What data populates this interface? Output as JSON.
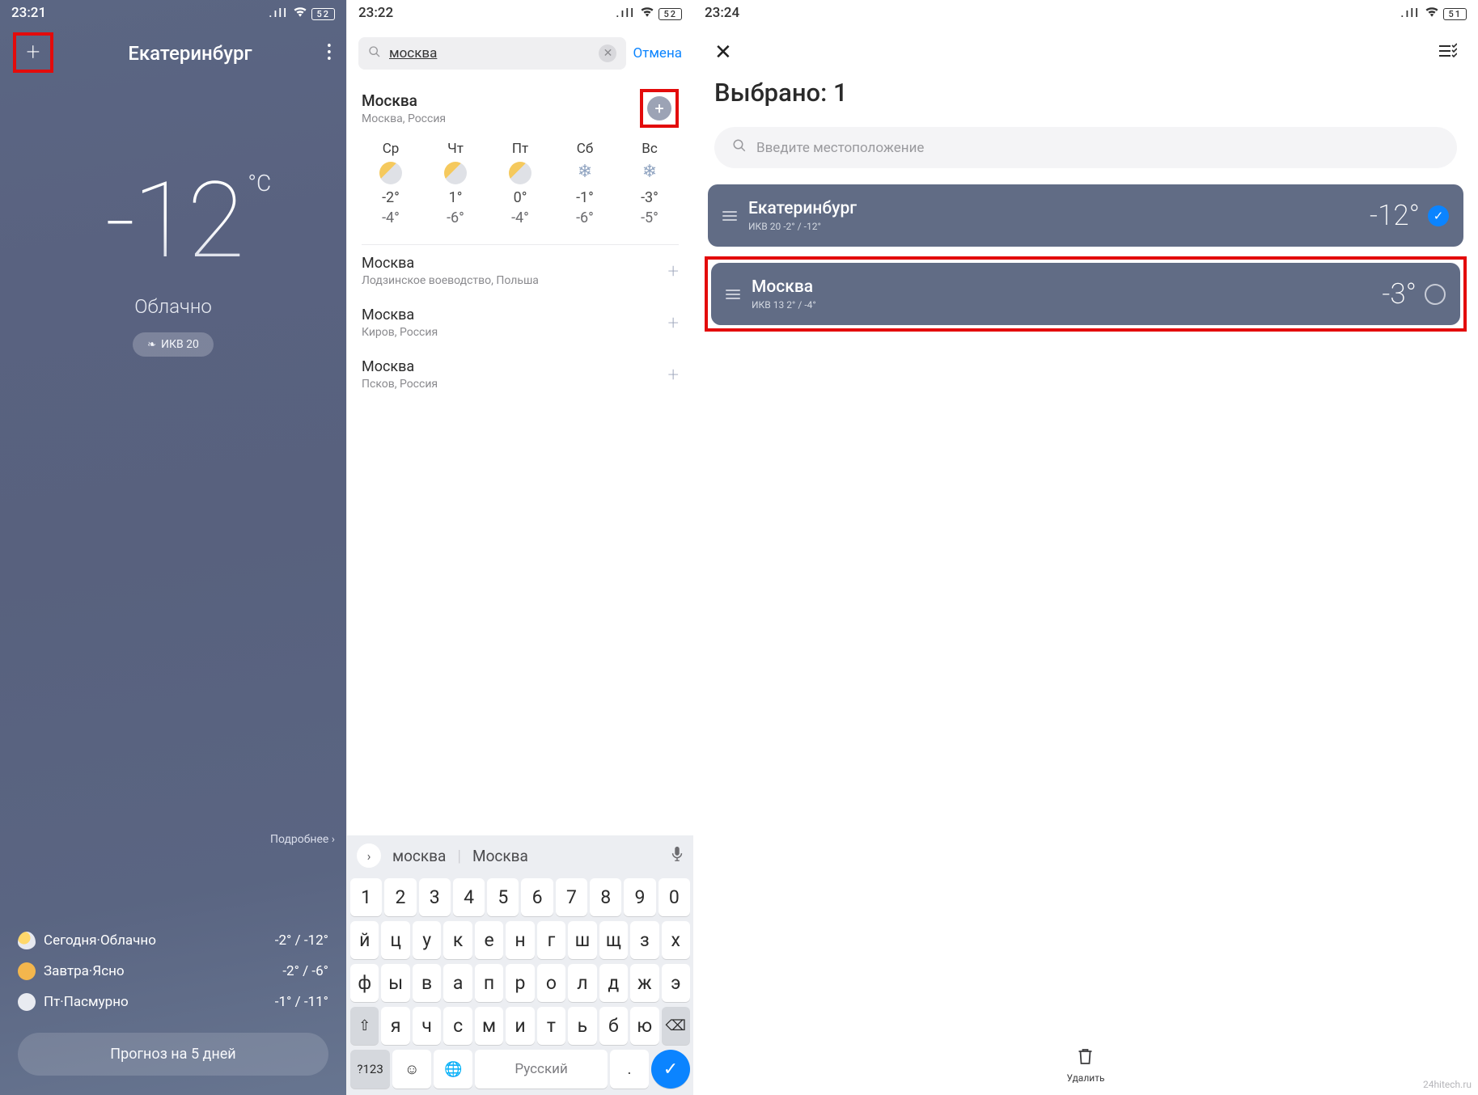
{
  "status": {
    "battery1": "52",
    "battery2": "52",
    "battery3": "51",
    "signal": "▫▪▪▪",
    "wifi": "📶"
  },
  "s1": {
    "time": "23:21",
    "city": "Екатеринбург",
    "temp": "-12",
    "unit": "°C",
    "condition": "Облачно",
    "aqi": "ИКВ 20",
    "details": "Подробнее ",
    "days": [
      {
        "label": "Сегодня·Облачно",
        "range": "-2° / -12°"
      },
      {
        "label": "Завтра·Ясно",
        "range": "-2° / -6°"
      },
      {
        "label": "Пт·Пасмурно",
        "range": "-1° / -11°"
      }
    ],
    "forecast_btn": "Прогноз на 5 дней"
  },
  "s2": {
    "time": "23:22",
    "query": "москва",
    "cancel": "Отмена",
    "primary": {
      "title": "Москва",
      "sub": "Москва, Россия"
    },
    "forecast": [
      {
        "d": "Ср",
        "icon": "pc",
        "hi": "-2°",
        "lo": "-4°"
      },
      {
        "d": "Чт",
        "icon": "pc",
        "hi": "1°",
        "lo": "-6°"
      },
      {
        "d": "Пт",
        "icon": "pc",
        "hi": "0°",
        "lo": "-4°"
      },
      {
        "d": "Сб",
        "icon": "snow",
        "hi": "-1°",
        "lo": "-6°"
      },
      {
        "d": "Вс",
        "icon": "snow",
        "hi": "-3°",
        "lo": "-5°"
      }
    ],
    "alts": [
      {
        "title": "Москва",
        "sub": "Лодзинское воеводство, Польша"
      },
      {
        "title": "Москва",
        "sub": "Киров, Россия"
      },
      {
        "title": "Москва",
        "sub": "Псков, Россия"
      }
    ],
    "kbd": {
      "sug1": "москва",
      "sug2": "Москва",
      "row1": [
        "1",
        "2",
        "3",
        "4",
        "5",
        "6",
        "7",
        "8",
        "9",
        "0"
      ],
      "row2": [
        "й",
        "ц",
        "у",
        "к",
        "е",
        "н",
        "г",
        "ш",
        "щ",
        "з",
        "х"
      ],
      "row3": [
        "ф",
        "ы",
        "в",
        "а",
        "п",
        "р",
        "о",
        "л",
        "д",
        "ж",
        "э"
      ],
      "row4": [
        "⇧",
        "я",
        "ч",
        "с",
        "м",
        "и",
        "т",
        "ь",
        "б",
        "ю",
        "⌫"
      ],
      "numkey": "?123",
      "space": "Русский"
    }
  },
  "s3": {
    "time": "23:24",
    "title": "Выбрано: 1",
    "search_placeholder": "Введите местоположение",
    "cards": [
      {
        "city": "Екатеринбург",
        "sub": "ИКВ 20   -2° / -12°",
        "temp": "-12°",
        "selected": true
      },
      {
        "city": "Москва",
        "sub": "ИКВ 13   2° / -4°",
        "temp": "-3°",
        "selected": false
      }
    ],
    "delete": "Удалить"
  },
  "watermark": "24hitech.ru"
}
